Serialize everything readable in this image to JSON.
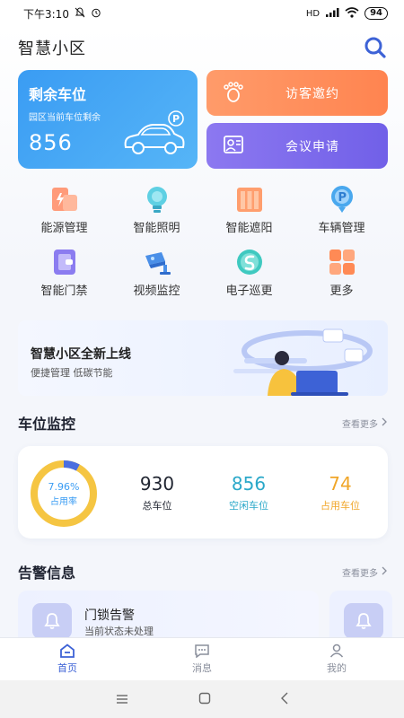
{
  "status_bar": {
    "time": "下午3:10",
    "signal": "HD",
    "battery": "94"
  },
  "header": {
    "title": "智慧小区"
  },
  "parking_card": {
    "title": "剩余车位",
    "subtitle": "园区当前车位剩余",
    "value": "856"
  },
  "actions": {
    "visit_label": "访客邀约",
    "meeting_label": "会议申请"
  },
  "grid": [
    {
      "label": "能源管理",
      "icon": "energy-icon"
    },
    {
      "label": "智能照明",
      "icon": "bulb-icon"
    },
    {
      "label": "智能遮阳",
      "icon": "blinds-icon"
    },
    {
      "label": "车辆管理",
      "icon": "parking-icon"
    },
    {
      "label": "智能门禁",
      "icon": "door-access-icon"
    },
    {
      "label": "视频监控",
      "icon": "camera-icon"
    },
    {
      "label": "电子巡更",
      "icon": "patrol-icon"
    },
    {
      "label": "更多",
      "icon": "more-grid-icon"
    }
  ],
  "banner": {
    "title": "智慧小区全新上线",
    "subtitle": "便捷管理 低碳节能"
  },
  "parking_monitor": {
    "title": "车位监控",
    "see_more": "查看更多",
    "occupancy_percent": "7.96%",
    "occupancy_fraction": 0.0796,
    "occupancy_caption": "占用率",
    "stats": [
      {
        "value": "930",
        "label": "总车位",
        "color": "#1f2430"
      },
      {
        "value": "856",
        "label": "空闲车位",
        "color": "#2aa8c9"
      },
      {
        "value": "74",
        "label": "占用车位",
        "color": "#f0a628"
      }
    ]
  },
  "alerts": {
    "title": "告警信息",
    "see_more": "查看更多",
    "items": [
      {
        "title": "门锁告警",
        "status": "当前状态未处理"
      }
    ]
  },
  "tabs": [
    {
      "label": "首页",
      "icon": "home-icon",
      "active": true
    },
    {
      "label": "消息",
      "icon": "message-icon",
      "active": false
    },
    {
      "label": "我的",
      "icon": "profile-icon",
      "active": false
    }
  ],
  "colors": {
    "accent": "#3d62d6",
    "parking_blue": "#3a9cf3",
    "visit_orange": "#ff8a55",
    "meeting_purple": "#7a68ec",
    "ring_yellow": "#f5c542",
    "ring_blue": "#4a6ee0"
  }
}
